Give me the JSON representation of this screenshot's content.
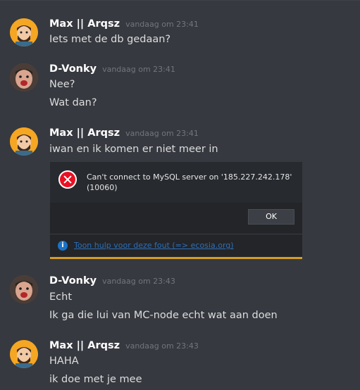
{
  "messages": [
    {
      "author": "Max || Arqsz",
      "timestamp": "vandaag om 23:41",
      "lines": [
        "Iets met de db gedaan?"
      ]
    },
    {
      "author": "D-Vonky",
      "timestamp": "vandaag om 23:41",
      "lines": [
        "Nee?",
        "Wat dan?"
      ]
    },
    {
      "author": "Max || Arqsz",
      "timestamp": "vandaag om 23:41",
      "lines": [
        "iwan en ik komen er niet meer in"
      ],
      "dialog": {
        "error_text": "Can't connect to MySQL server on '185.227.242.178' (10060)",
        "ok_label": "OK",
        "help_link": "Toon hulp voor deze fout (=> ecosia.org)",
        "info_glyph": "i"
      }
    },
    {
      "author": "D-Vonky",
      "timestamp": "vandaag om 23:43",
      "lines": [
        "Echt",
        "Ik ga die lui van MC-node echt wat aan doen"
      ]
    },
    {
      "author": "Max || Arqsz",
      "timestamp": "vandaag om 23:43",
      "lines": [
        "HAHA",
        "ik doe met je mee"
      ]
    }
  ],
  "colors": {
    "background": "#36393f",
    "username": "#ffffff",
    "timestamp": "#72767d",
    "message_text": "#dcddde",
    "error_red": "#e81123",
    "info_blue": "#1a73c9",
    "dialog_accent": "#d79b22"
  },
  "icons": {
    "error": "error-x-icon",
    "info": "info-icon"
  }
}
